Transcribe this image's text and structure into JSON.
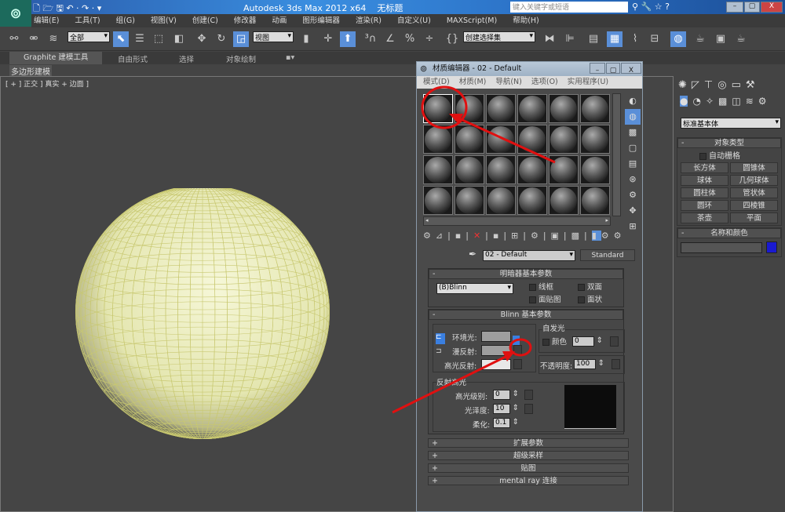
{
  "app": {
    "title": "Autodesk 3ds Max  2012 x64",
    "doc": "无标题",
    "search_placeholder": "键入关键字或短语"
  },
  "menu": [
    "编辑(E)",
    "工具(T)",
    "组(G)",
    "视图(V)",
    "创建(C)",
    "修改器",
    "动画",
    "图形编辑器",
    "渲染(R)",
    "自定义(U)",
    "MAXScript(M)",
    "帮助(H)"
  ],
  "toolbar": {
    "filter": "全部",
    "coord": "视图",
    "selset": "创建选择集"
  },
  "ribbon": {
    "tabs": [
      "Graphite 建模工具",
      "自由形式",
      "选择",
      "对象绘制"
    ],
    "sub": "多边形建模"
  },
  "viewport": {
    "label": "[ + ] 正交 ] 真实 + 边面 ]"
  },
  "sphere": {
    "color": "#e8e9b8",
    "wire": "#c8c870"
  },
  "cmd": {
    "category": "标准基本体",
    "object_type": "对象类型",
    "autogrid": "自动栅格",
    "buttons": [
      "长方体",
      "圆锥体",
      "球体",
      "几何球体",
      "圆柱体",
      "管状体",
      "圆环",
      "四棱锥",
      "茶壶",
      "平面"
    ],
    "name_color": "名称和颜色",
    "obj_color": "#1a1ad0"
  },
  "medit": {
    "title": "材质编辑器 - 02 - Default",
    "menu": [
      "模式(D)",
      "材质(M)",
      "导航(N)",
      "选项(O)",
      "实用程序(U)"
    ],
    "material_name": "02 - Default",
    "type": "Standard",
    "shader": {
      "header": "明暗器基本参数",
      "shader": "(B)Blinn",
      "wire": "线框",
      "twosided": "双面",
      "facemap": "面贴图",
      "faceted": "面状"
    },
    "blinn": {
      "header": "Blinn 基本参数",
      "self_illum": "自发光",
      "color": "颜色",
      "self_illum_value": "0",
      "ambient": "环境光:",
      "diffuse": "漫反射:",
      "specular": "高光反射:",
      "opacity_label": "不透明度:",
      "opacity": "100",
      "spec_highlights": "反射高光",
      "spec_level_label": "高光级别:",
      "spec_level": "0",
      "gloss_label": "光泽度:",
      "gloss": "10",
      "soften_label": "柔化:",
      "soften": "0.1"
    },
    "rollouts": [
      "扩展参数",
      "超级采样",
      "贴图",
      "mental ray 连接"
    ]
  },
  "annotation_color": "#e01010"
}
